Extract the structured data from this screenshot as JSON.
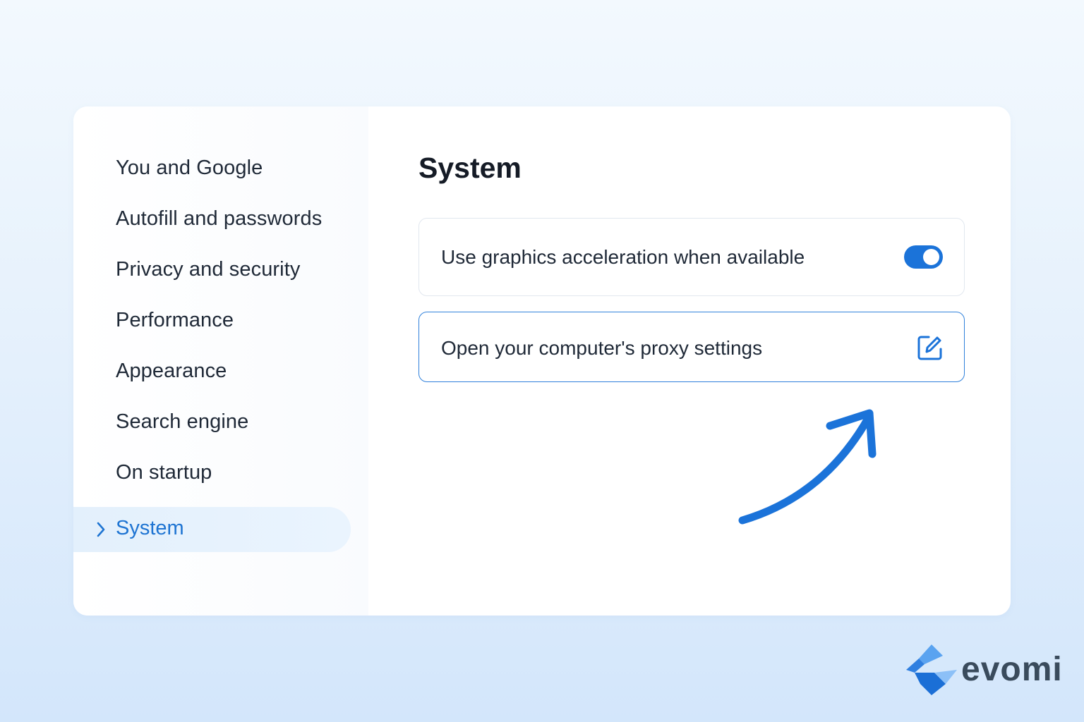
{
  "sidebar": {
    "items": [
      {
        "label": "You and Google"
      },
      {
        "label": "Autofill and passwords"
      },
      {
        "label": "Privacy and security"
      },
      {
        "label": "Performance"
      },
      {
        "label": "Appearance"
      },
      {
        "label": "Search engine"
      },
      {
        "label": "On startup"
      },
      {
        "label": "System",
        "active": true
      }
    ]
  },
  "main": {
    "title": "System",
    "settings": [
      {
        "label": "Use graphics acceleration when available",
        "control": "toggle",
        "state": "on"
      },
      {
        "label": "Open your computer's proxy settings",
        "control": "external-link-icon"
      }
    ]
  },
  "annotation": {
    "icon": "curved-arrow-icon",
    "color": "#1b73d9"
  },
  "brand": {
    "name": "evomi",
    "icon": "evomi-logo-icon"
  },
  "colors": {
    "accent": "#1b73d9",
    "active_bg": "#e3f0fc",
    "text": "#1f2937"
  }
}
